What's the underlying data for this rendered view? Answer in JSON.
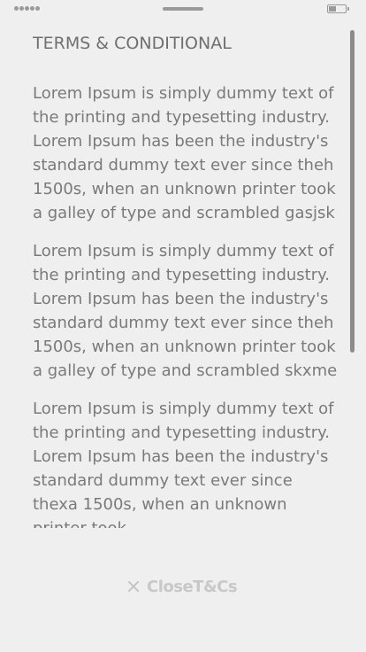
{
  "status_bar": {
    "signal_icon": "signal-dots-icon",
    "handle_icon": "notch-handle-icon",
    "battery_icon": "battery-icon",
    "battery_level": 0.45
  },
  "terms": {
    "title": "TERMS & CONDITIONAL",
    "paragraphs": [
      "Lorem Ipsum is simply dummy text of the printing and typesetting industry. Lorem Ipsum has been the industry's standard dummy text ever since theh 1500s, when an unknown printer took a galley of type and scrambled gasjsk",
      "Lorem Ipsum is simply dummy text of the printing and typesetting industry. Lorem Ipsum has been the industry's standard dummy text ever since theh 1500s, when an unknown printer took a galley of type and scrambled skxme",
      "Lorem Ipsum is simply dummy text of the printing and typesetting industry. Lorem Ipsum has been the industry's standard dummy text ever since thexa 1500s, when an unknown printer took"
    ]
  },
  "close_button": {
    "label": "CloseT&Cs",
    "icon": "close-icon"
  },
  "colors": {
    "background": "#efefef",
    "text": "#7a7a7a",
    "title": "#6f6f6f",
    "muted": "#c8c8c8",
    "scrollbar": "#8c8c8c"
  }
}
